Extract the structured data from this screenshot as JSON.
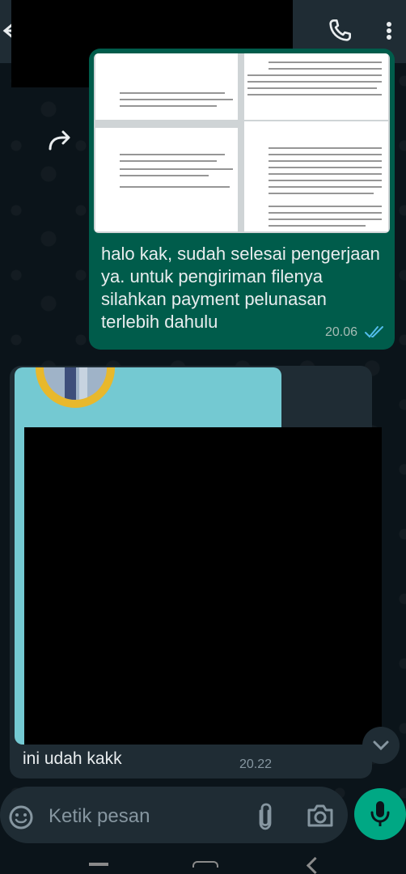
{
  "header": {
    "back_icon": "arrow-left-icon",
    "call_icon": "phone-icon",
    "menu_icon": "more-vertical-icon"
  },
  "messages": [
    {
      "direction": "outgoing",
      "forward_icon": "forward-icon",
      "attachment": "document-preview",
      "text": "halo kak, sudah selesai pengerjaan ya. untuk pengiriman filenya silahkan payment pelunasan terlebih dahulu",
      "time": "20.06",
      "status_icon": "double-check-read-icon"
    },
    {
      "direction": "incoming",
      "attachment": "image-preview",
      "text": "ini udah kakk",
      "time": "20.22"
    }
  ],
  "composer": {
    "placeholder": "Ketik pesan",
    "emoji_icon": "emoji-icon",
    "attach_icon": "paperclip-icon",
    "camera_icon": "camera-icon",
    "mic_icon": "microphone-icon"
  },
  "scroll_icon": "chevron-down-icon",
  "colors": {
    "header_bg": "#1f2c34",
    "chat_bg": "#0b141a",
    "outgoing_bubble": "#005c4b",
    "incoming_bubble": "#1f2c34",
    "accent": "#00a884",
    "read_tick": "#53bdeb"
  }
}
